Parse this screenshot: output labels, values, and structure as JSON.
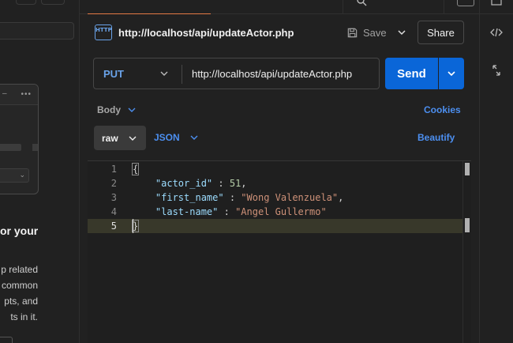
{
  "request": {
    "title": "http://localhost/api/updateActor.php",
    "icon": "http-icon",
    "icon_text": "HTTP",
    "save_label": "Save",
    "share_label": "Share",
    "method": "PUT",
    "url": "http://localhost/api/updateActor.php",
    "send_label": "Send"
  },
  "body_section": {
    "label": "Body",
    "cookies_label": "Cookies",
    "mode": "raw",
    "language": "JSON",
    "beautify_label": "Beautify"
  },
  "editor": {
    "line_numbers": [
      "1",
      "2",
      "3",
      "4",
      "5"
    ],
    "active_line": 5,
    "lines": {
      "l1": "{",
      "l2_key": "\"actor_id\"",
      "l2_sep": " : ",
      "l2_val": "51",
      "l2_end": ",",
      "l3_key": "\"first_name\"",
      "l3_sep": " : ",
      "l3_val": "\"Wong Valenzuela\"",
      "l3_end": ",",
      "l4_key": "\"last-name\"",
      "l4_sep": " : ",
      "l4_val": "\"Angel Gullermo\"",
      "l5": "}"
    }
  },
  "left_panel": {
    "heading_fragment": "or your",
    "paragraph_fragments": [
      "p related",
      "common",
      "pts, and",
      "ts in it."
    ],
    "card_dots": "•••",
    "card_dash": "–"
  },
  "colors": {
    "accent_blue": "#0a66d8",
    "link_blue": "#4c8ff0",
    "tab_active": "#e37a45"
  }
}
